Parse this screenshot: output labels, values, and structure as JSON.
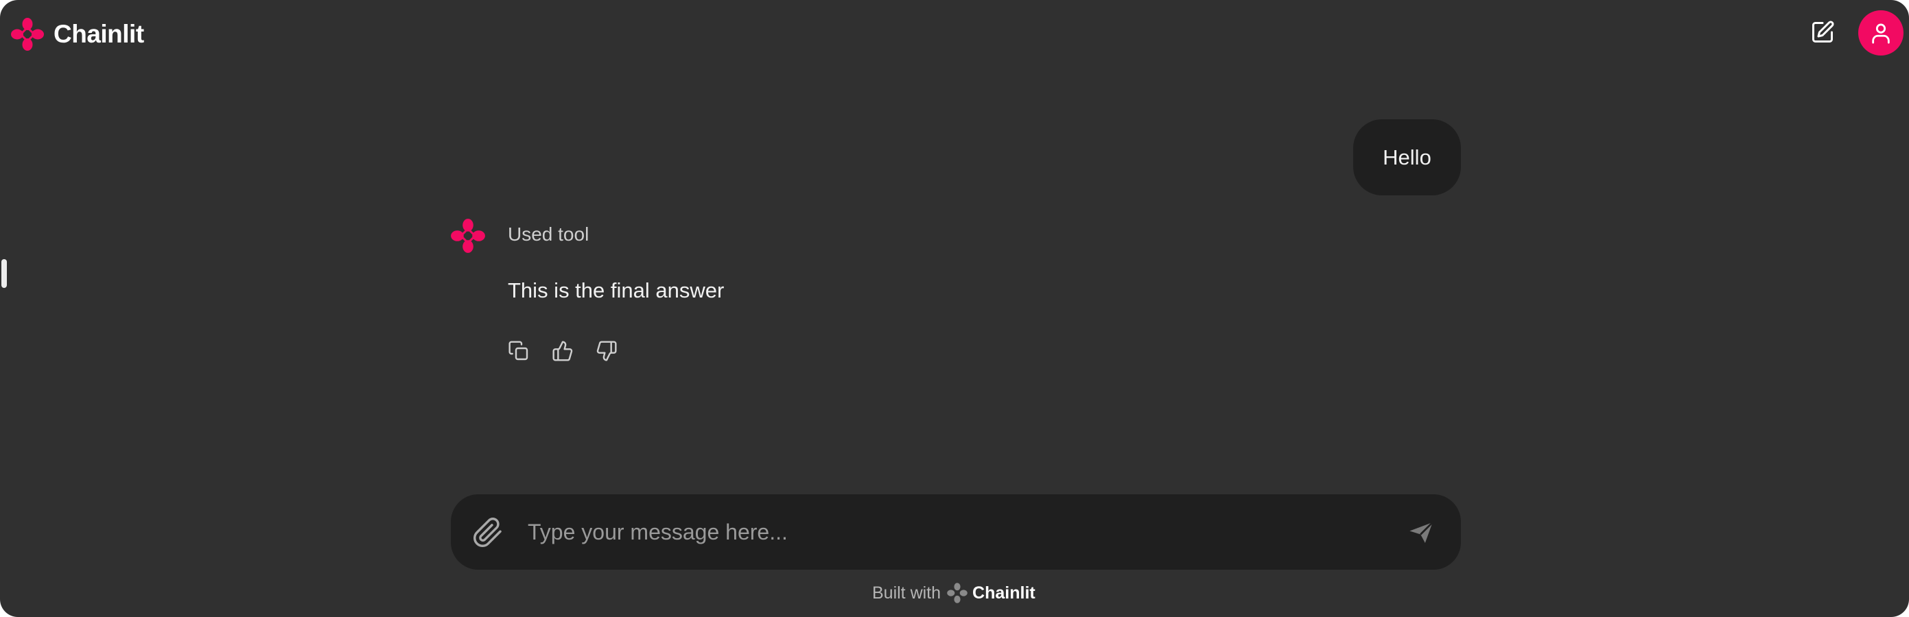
{
  "header": {
    "brand_name": "Chainlit",
    "logo_icon": "chainlit-logo-icon",
    "new_chat_icon": "new-chat-edit-icon",
    "user_icon": "user-icon"
  },
  "conversation": {
    "user_message": "Hello",
    "assistant": {
      "step_label": "Used tool",
      "answer": "This is the final answer",
      "actions": [
        {
          "icon": "copy-icon"
        },
        {
          "icon": "thumbs-up-icon"
        },
        {
          "icon": "thumbs-down-icon"
        }
      ]
    }
  },
  "composer": {
    "placeholder": "Type your message here...",
    "value": "",
    "attach_icon": "paperclip-icon",
    "send_icon": "send-icon"
  },
  "footer": {
    "text": "Built with",
    "brand": "Chainlit"
  },
  "colors": {
    "background": "#303030",
    "surface": "#1f1f1f",
    "accent": "#f20a62",
    "text": "#f2f2f2",
    "muted_text": "#9a9a9a"
  }
}
